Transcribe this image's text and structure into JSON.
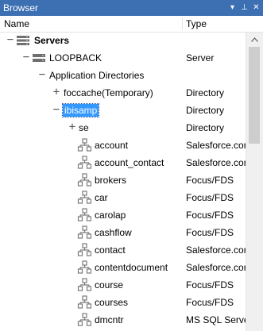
{
  "window": {
    "title": "Browser",
    "menu_glyph": "▾",
    "pin_glyph": "⊥",
    "close_glyph": "✕"
  },
  "columns": {
    "name": "Name",
    "type": "Type"
  },
  "tree": {
    "servers": {
      "label": "Servers",
      "toggle": "−"
    },
    "loopback": {
      "label": "LOOPBACK",
      "type": "Server",
      "toggle": "−"
    },
    "app_dirs": {
      "label": "Application Directories",
      "toggle": "−"
    },
    "foccache": {
      "label": "foccache(Temporary)",
      "type": "Directory",
      "toggle": "+"
    },
    "ibisamp": {
      "label": "ibisamp",
      "type": "Directory",
      "toggle": "−"
    },
    "se": {
      "label": "se",
      "type": "Directory",
      "toggle": "+"
    },
    "items": [
      {
        "label": "account",
        "type": "Salesforce.com"
      },
      {
        "label": "account_contact",
        "type": "Salesforce.com"
      },
      {
        "label": "brokers",
        "type": "Focus/FDS"
      },
      {
        "label": "car",
        "type": "Focus/FDS"
      },
      {
        "label": "carolap",
        "type": "Focus/FDS"
      },
      {
        "label": "cashflow",
        "type": "Focus/FDS"
      },
      {
        "label": "contact",
        "type": "Salesforce.com"
      },
      {
        "label": "contentdocument",
        "type": "Salesforce.com"
      },
      {
        "label": "course",
        "type": "Focus/FDS"
      },
      {
        "label": "courses",
        "type": "Focus/FDS"
      },
      {
        "label": "dmcntr",
        "type": "MS SQL Server"
      }
    ]
  },
  "colors": {
    "titlebar": "#3d6fb3",
    "selection": "#3399ff",
    "scroll_thumb": "#cdcdcd"
  }
}
